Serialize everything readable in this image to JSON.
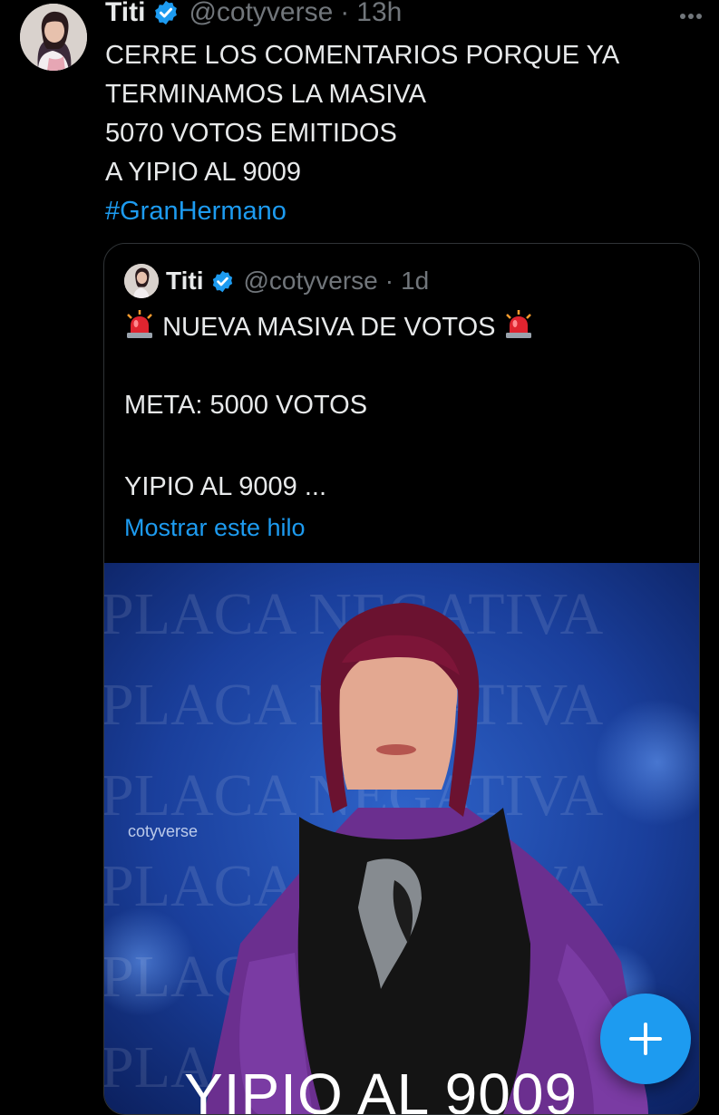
{
  "tweet": {
    "name": "Titi",
    "handle": "@cotyverse",
    "separator": "·",
    "time": "13h",
    "lines": [
      "CERRE LOS COMENTARIOS PORQUE YA",
      "TERMINAMOS LA MASIVA",
      "5070 VOTOS EMITIDOS",
      "A YIPIO AL 9009"
    ],
    "hashtag": "#GranHermano"
  },
  "quoted": {
    "name": "Titi",
    "handle": "@cotyverse",
    "separator": "·",
    "time": "1d",
    "headline": "NUEVA MASIVA DE VOTOS",
    "goal": "META: 5000 VOTOS",
    "teaser": "YIPIO AL 9009 ...",
    "show_thread": "Mostrar este hilo",
    "image": {
      "bg_text": "PLACA NEGATIVA",
      "watermark": "cotyverse",
      "caption": "YIPIO AL 9009"
    }
  },
  "colors": {
    "background": "#000000",
    "text": "#e7e9ea",
    "secondary": "#71767b",
    "accent": "#1d9bf0",
    "border": "#2f3336"
  },
  "icons": {
    "verified": "verified-badge-icon",
    "more": "more-options-icon",
    "siren": "siren-emoji-icon",
    "compose": "plus-icon"
  }
}
